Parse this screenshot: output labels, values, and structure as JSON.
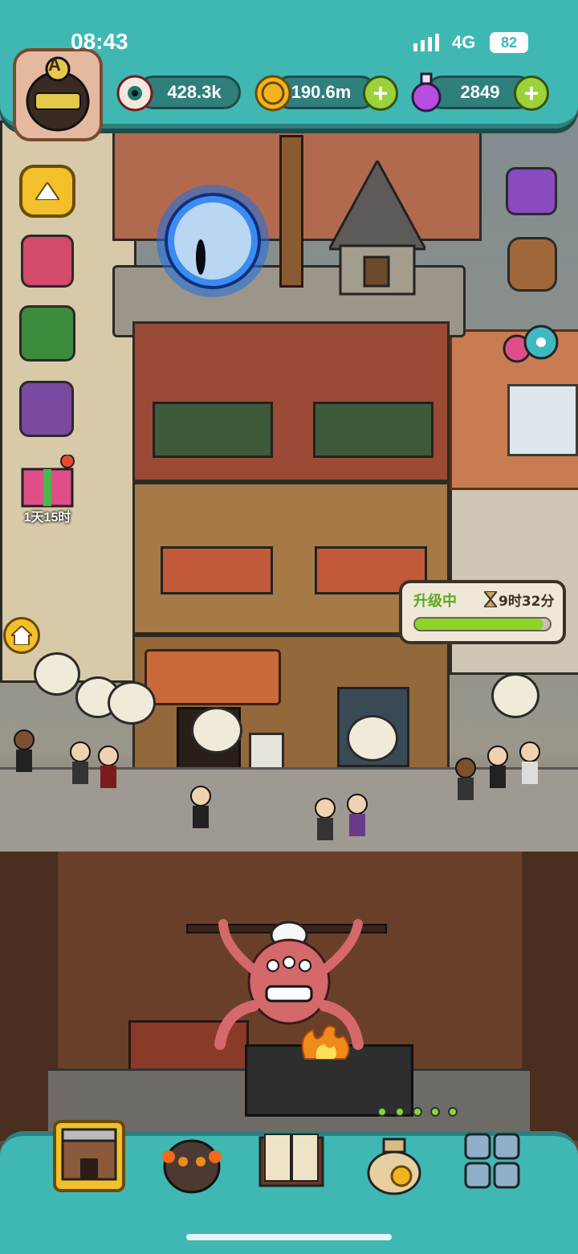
{
  "status_bar": {
    "time": "08:43",
    "network": "4G",
    "battery": "82"
  },
  "player": {
    "rank_badge": "A"
  },
  "resources": {
    "eyeballs": {
      "icon": "eyeball-icon",
      "value": "428.3k"
    },
    "coins": {
      "icon": "coin-icon",
      "value": "190.6m"
    },
    "potions": {
      "icon": "potion-icon",
      "value": "2849"
    }
  },
  "side_left": {
    "event_timer": "1天15时"
  },
  "upgrade_bubble": {
    "label": "升级中",
    "timer": "9时32分",
    "progress_fraction": 0.95
  },
  "bottom_nav": [
    {
      "name": "building",
      "icon": "building-icon"
    },
    {
      "name": "monster",
      "icon": "monster-icon"
    },
    {
      "name": "recipe-book",
      "icon": "book-icon"
    },
    {
      "name": "money-bag",
      "icon": "money-bag-icon"
    },
    {
      "name": "more",
      "icon": "grid-icon"
    }
  ],
  "colors": {
    "hud_teal": "#3fb8b4",
    "hud_dark": "#2f7f7c",
    "plus_green": "#9bd13a",
    "progress_green": "#8fd42a"
  }
}
